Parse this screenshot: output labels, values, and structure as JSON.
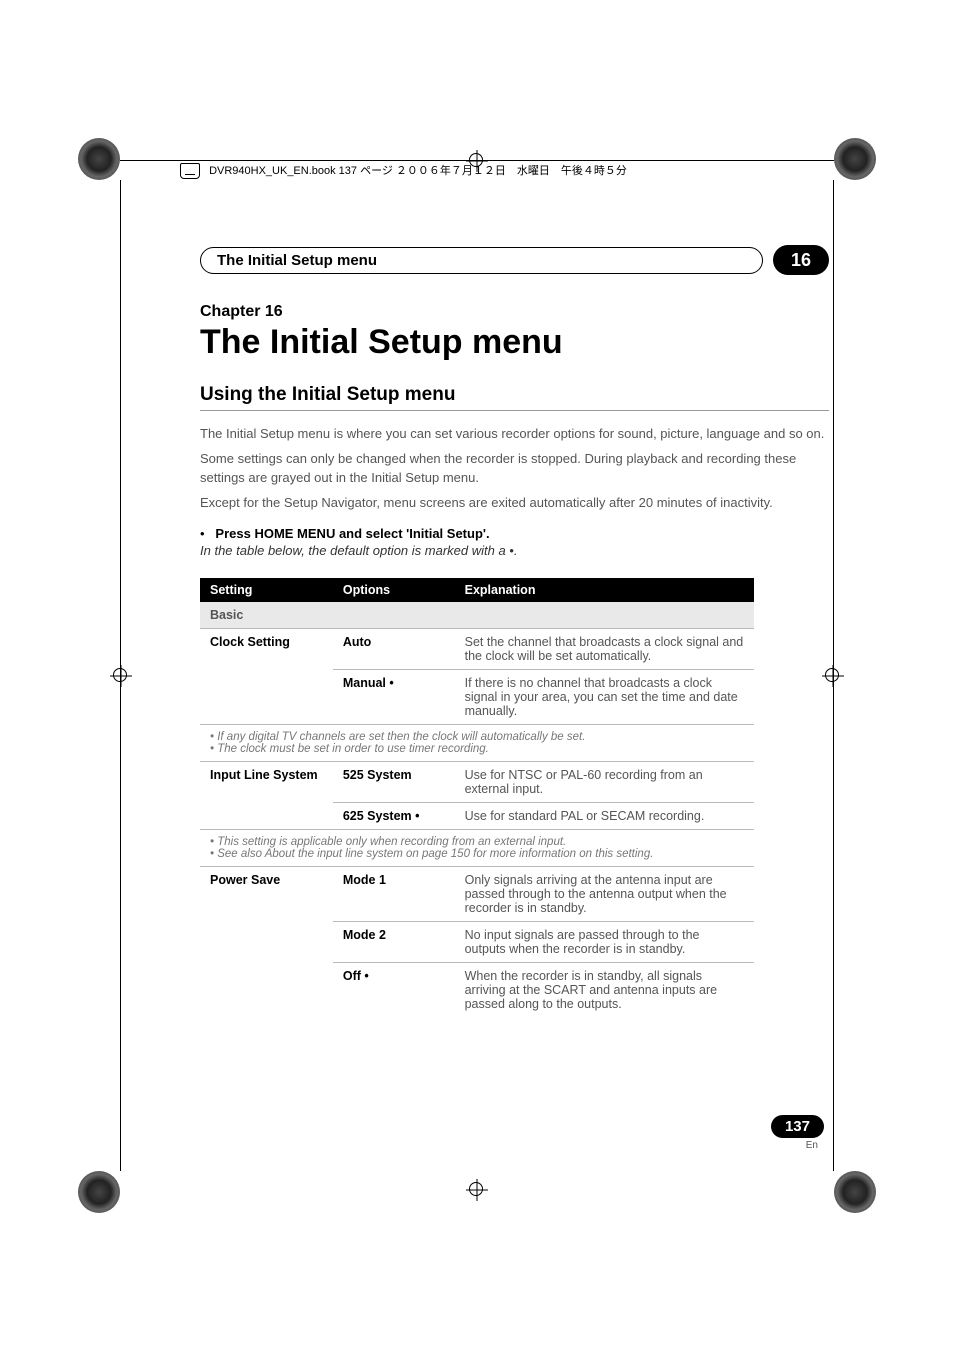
{
  "bookline": "DVR940HX_UK_EN.book  137 ページ  ２００６年７月１２日　水曜日　午後４時５分",
  "header": {
    "title": "The Initial Setup menu",
    "chapnum": "16"
  },
  "chapter": {
    "label": "Chapter 16",
    "title": "The Initial Setup menu"
  },
  "section": {
    "title": "Using the Initial Setup menu"
  },
  "paras": {
    "p1": "The Initial Setup menu is where you can set various recorder options for sound, picture, language and so on.",
    "p2": "Some settings can only be changed when the recorder is stopped. During playback and recording these settings are grayed out in the Initial Setup menu.",
    "p3": "Except for the Setup Navigator, menu screens are exited automatically after 20 minutes of inactivity."
  },
  "bullet": {
    "marker": "•",
    "bold": "Press HOME MENU and select 'Initial Setup'."
  },
  "italic_line": "In the table below, the default option is marked with a  •.",
  "table": {
    "head": {
      "c1": "Setting",
      "c2": "Options",
      "c3": "Explanation"
    },
    "basic": "Basic",
    "clock": {
      "label": "Clock Setting",
      "r1_opt": "Auto",
      "r1_exp": "Set the channel that broadcasts a clock signal and the clock will be set automatically.",
      "r2_opt": "Manual •",
      "r2_exp": "If there is no channel that broadcasts a clock signal in your area, you can set the time and date manually.",
      "note1": "• If any digital TV channels are set then the clock will automatically be set.",
      "note2": "• The clock must be set in order to use timer recording."
    },
    "input": {
      "label": "Input Line System",
      "r1_opt": "525 System",
      "r1_exp": "Use for NTSC or PAL-60 recording from an external input.",
      "r2_opt": "625 System •",
      "r2_exp": "Use for standard PAL or SECAM recording.",
      "note1": "• This setting is applicable only when recording from an external input.",
      "note2": "• See also About the input line system on page 150 for more information on this setting."
    },
    "power": {
      "label": "Power Save",
      "r1_opt": "Mode 1",
      "r1_exp": "Only signals arriving at the antenna input are passed through to the antenna output when the recorder is in standby.",
      "r2_opt": "Mode 2",
      "r2_exp": "No input signals are passed through to the outputs when the recorder is in standby.",
      "r3_opt": "Off •",
      "r3_exp": "When the recorder is in standby, all signals arriving at the SCART and antenna inputs are passed along to the outputs."
    }
  },
  "footer": {
    "pagenum": "137",
    "lang": "En"
  }
}
